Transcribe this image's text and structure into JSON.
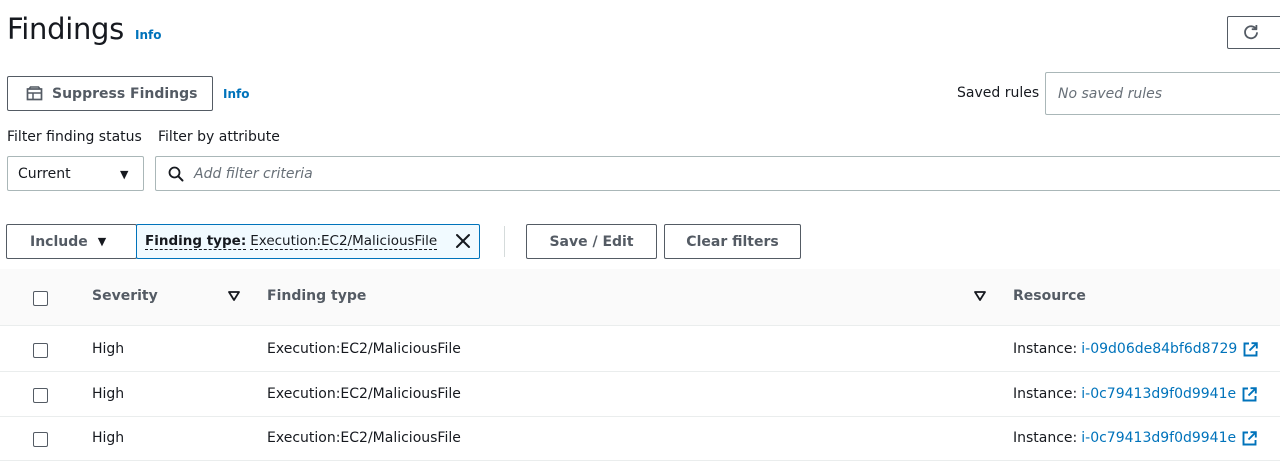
{
  "header": {
    "title": "Findings",
    "info_label": "Info"
  },
  "toolbar": {
    "suppress_label": "Suppress Findings",
    "info_label": "Info"
  },
  "saved_rules": {
    "label": "Saved rules",
    "placeholder": "No saved rules"
  },
  "filters": {
    "status_label": "Filter finding status",
    "attribute_label": "Filter by attribute",
    "status_value": "Current",
    "search_placeholder": "Add filter criteria"
  },
  "filter_bar": {
    "include_label": "Include",
    "token_key": "Finding type",
    "token_sep": ":",
    "token_value": "Execution:EC2/MaliciousFile",
    "save_label": "Save / Edit",
    "clear_label": "Clear filters"
  },
  "table": {
    "columns": [
      "Severity",
      "Finding type",
      "Resource"
    ],
    "rows": [
      {
        "severity": "High",
        "type": "Execution:EC2/MaliciousFile",
        "resource_prefix": "Instance:",
        "resource_id": "i-09d06de84bf6d8729"
      },
      {
        "severity": "High",
        "type": "Execution:EC2/MaliciousFile",
        "resource_prefix": "Instance:",
        "resource_id": "i-0c79413d9f0d9941e"
      },
      {
        "severity": "High",
        "type": "Execution:EC2/MaliciousFile",
        "resource_prefix": "Instance:",
        "resource_id": "i-0c79413d9f0d9941e"
      }
    ]
  },
  "colors": {
    "link": "#0073bb",
    "text": "#16191f",
    "border": "#aab7b8",
    "token_bg": "#f1faff"
  },
  "icons": [
    "refresh-icon",
    "suppress-icon",
    "search-icon",
    "close-icon",
    "caret-down-icon",
    "sort-icon",
    "external-link-icon"
  ]
}
